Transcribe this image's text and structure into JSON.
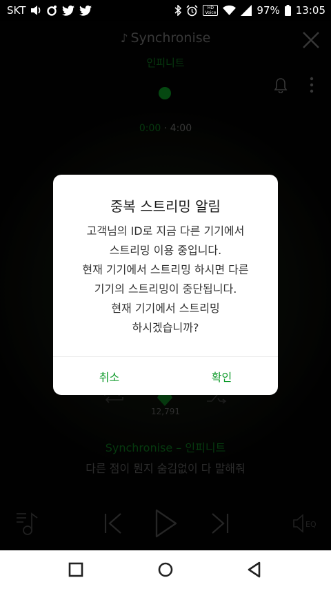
{
  "status_bar": {
    "carrier": "SKT",
    "battery": "97%",
    "time": "13:05",
    "hd_voice_line1": "HD",
    "hd_voice_line2": "Voice",
    "icons": [
      "volume-icon",
      "app-icon",
      "twitter-icon",
      "twitter-icon",
      "bluetooth-icon",
      "alarm-icon",
      "hd-voice-icon",
      "wifi-icon",
      "signal-icon",
      "battery-icon"
    ]
  },
  "player": {
    "title": "Synchronise",
    "artist": "인피니트",
    "time_current": "0:00",
    "time_separator": "·",
    "time_total": "4:00",
    "like_count": "12,791",
    "now_playing_title": "Synchronise – 인피니트",
    "lyric": "다른 점이 뭔지 숨김없이 다 말해줘"
  },
  "dialog": {
    "title": "중복 스트리밍 알림",
    "message_lines": [
      "고객님의 ID로 지금 다른 기기에서",
      "스트리밍 이용 중입니다.",
      "현재 기기에서 스트리밍 하시면 다른",
      "기기의 스트리밍이 중단됩니다.",
      "현재 기기에서 스트리밍",
      "하시겠습니까?"
    ],
    "cancel_label": "취소",
    "confirm_label": "확인"
  },
  "colors": {
    "accent": "#0e9a2a",
    "accent_dim": "#0d6d1c",
    "muted": "#6d6d6d"
  }
}
